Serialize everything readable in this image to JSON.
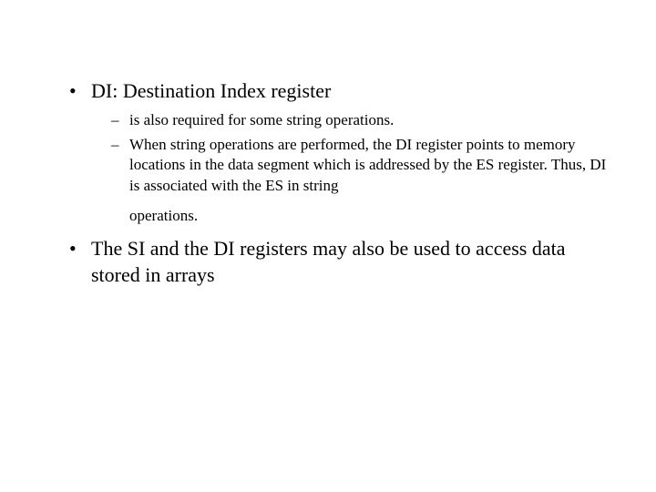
{
  "bullets": [
    {
      "text": "DI: Destination Index register",
      "sub": [
        {
          "text": "is also required for some string operations."
        },
        {
          "text": "When string operations are performed, the DI register points to memory locations in the data segment which is addressed by the ES register.  Thus, DI is associated with the ES in string",
          "trailing": "operations."
        }
      ]
    },
    {
      "text": "The SI and the DI registers may also be used to access data stored in arrays"
    }
  ]
}
